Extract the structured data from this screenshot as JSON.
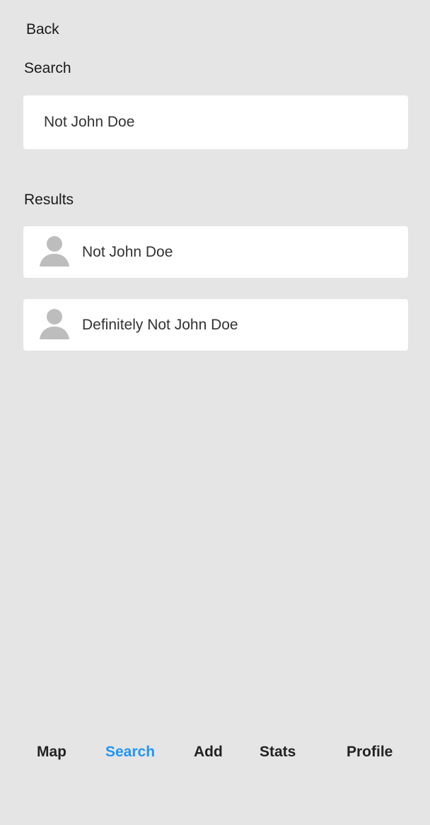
{
  "nav": {
    "back_label": "Back"
  },
  "search": {
    "label": "Search",
    "value": "Not John Doe"
  },
  "results": {
    "label": "Results",
    "items": [
      {
        "name": "Not John Doe",
        "icon": "person-icon"
      },
      {
        "name": "Definitely Not John Doe",
        "icon": "person-icon"
      }
    ]
  },
  "tabs": [
    {
      "label": "Map",
      "active": false
    },
    {
      "label": "Search",
      "active": true
    },
    {
      "label": "Add",
      "active": false
    },
    {
      "label": "Stats",
      "active": false
    },
    {
      "label": "Profile",
      "active": false
    }
  ],
  "colors": {
    "background": "#e5e5e5",
    "card": "#ffffff",
    "accent": "#2196f3",
    "avatar": "#bdbdbd"
  }
}
